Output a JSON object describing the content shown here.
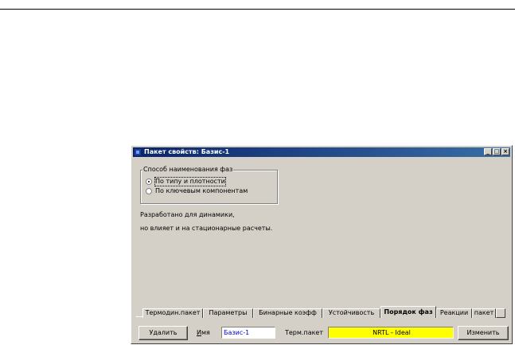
{
  "window": {
    "title": "Пакет свойств: Базис-1",
    "controls": {
      "minimize": "_",
      "maximize": "□",
      "close": "×"
    }
  },
  "phase_naming": {
    "group_label": "Способ наименования фаз",
    "options": [
      {
        "label": "По типу и плотности",
        "checked": true
      },
      {
        "label": "По ключевым компонентам",
        "checked": false
      }
    ]
  },
  "notes": {
    "line1": "Разработано для динамики,",
    "line2": "но влияет и на стационарные расчеты."
  },
  "tabs": [
    {
      "label": "Термодин.пакет",
      "active": false
    },
    {
      "label": "Параметры",
      "active": false
    },
    {
      "label": "Бинарные коэфф",
      "active": false
    },
    {
      "label": "Устойчивость",
      "active": false
    },
    {
      "label": "Порядок фаз",
      "active": true
    },
    {
      "label": "Реакции",
      "active": false
    },
    {
      "label": "пакет",
      "active": false
    }
  ],
  "bottom_bar": {
    "delete_label": "Удалить",
    "name_label": "Имя",
    "name_value": "Базис-1",
    "name_value_color": "#0000cc",
    "term_package_label": "Терм.пакет",
    "term_package_value": "NRTL - Ideal",
    "term_package_bg": "#ffff00",
    "change_label": "Изменить"
  }
}
